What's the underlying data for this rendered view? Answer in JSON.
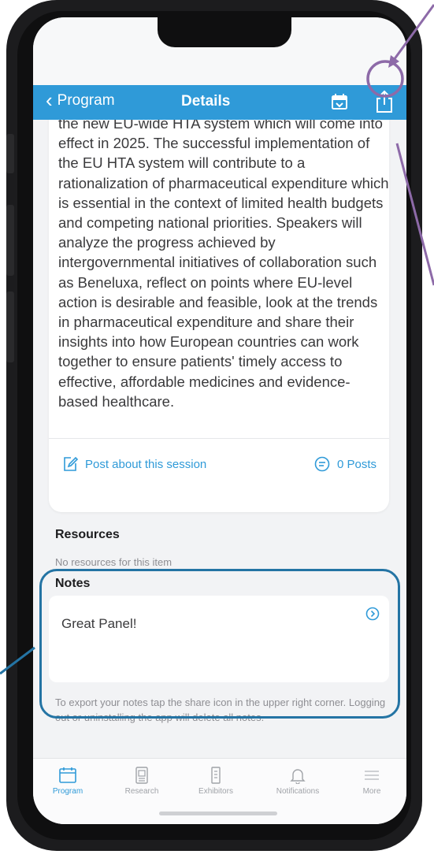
{
  "nav": {
    "back_label": "Program",
    "title": "Details",
    "calendar_icon": "calendar-add-icon",
    "share_icon": "share-icon"
  },
  "session": {
    "abstract": "the new EU-wide HTA system which will come into effect in 2025. The successful implementation of the EU HTA system will contribute to a rationalization of pharmaceutical expenditure which is essential in the context of limited health budgets and competing national priorities. Speakers will analyze the progress achieved by intergovernmental initiatives of collaboration such as Beneluxa, reflect on points where EU-level action is desirable and feasible, look at the trends in pharmaceutical expenditure and share their insights into how European countries can work together to ensure patients' timely access to effective, affordable medicines and evidence-based healthcare.",
    "post_label": "Post about this session",
    "posts_count_label": "0 Posts"
  },
  "resources": {
    "heading": "Resources",
    "empty_text": "No resources for this item"
  },
  "notes": {
    "heading": "Notes",
    "note_text": "Great Panel!",
    "export_hint": "To export your notes tap the share icon in the upper right corner. Logging out or uninstalling the app will delete all notes."
  },
  "tabbar": {
    "items": [
      {
        "label": "Program",
        "icon": "calendar-icon",
        "active": true
      },
      {
        "label": "Research",
        "icon": "document-icon",
        "active": false
      },
      {
        "label": "Exhibitors",
        "icon": "booklet-icon",
        "active": false
      },
      {
        "label": "Notifications",
        "icon": "bell-icon",
        "active": false
      },
      {
        "label": "More",
        "icon": "menu-icon",
        "active": false
      }
    ]
  },
  "colors": {
    "accent": "#2f9ad8",
    "annotation_purple": "#8d6aa8",
    "annotation_blue": "#2474a4"
  }
}
